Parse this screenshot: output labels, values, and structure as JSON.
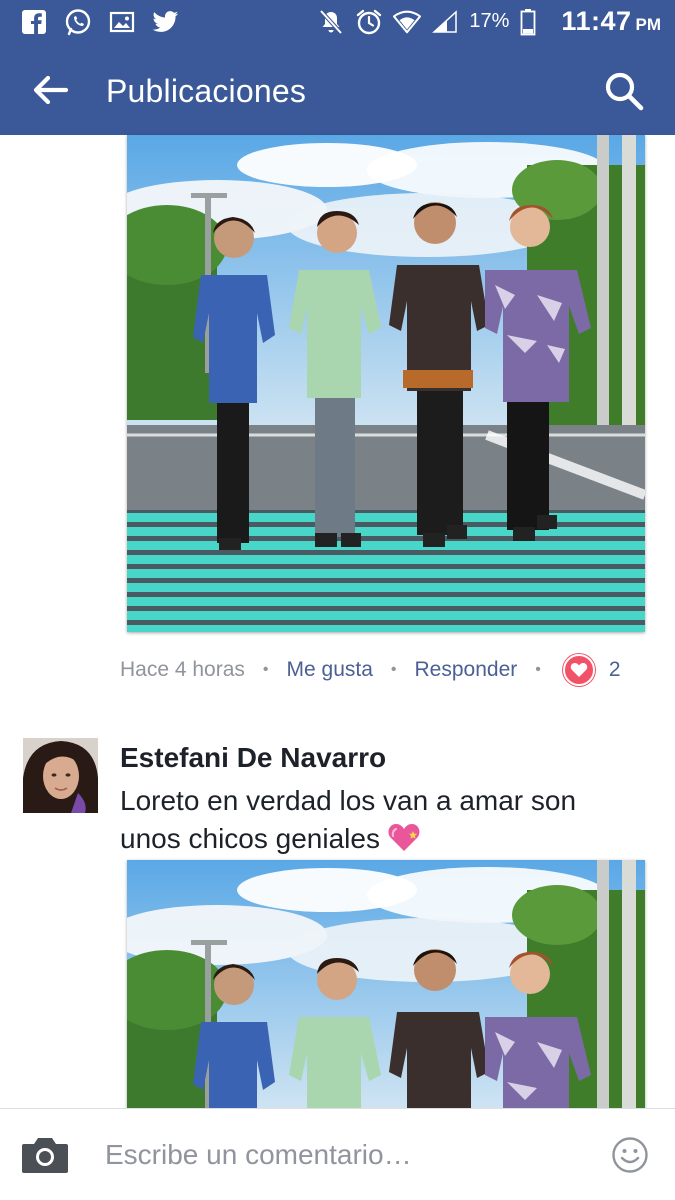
{
  "status_bar": {
    "battery": "17%",
    "time": "11:47",
    "ampm": "PM",
    "left_icons": [
      "facebook-icon",
      "whatsapp-icon",
      "gallery-icon",
      "twitter-icon"
    ],
    "right_icons": [
      "mute-bell-icon",
      "alarm-icon",
      "wifi-icon",
      "signal-icon",
      "battery-icon"
    ]
  },
  "header": {
    "title": "Publicaciones",
    "back_icon": "arrow-left-icon",
    "search_icon": "search-icon"
  },
  "post_meta": {
    "time": "Hace 4 horas",
    "like_label": "Me gusta",
    "reply_label": "Responder",
    "reaction": "heart",
    "reaction_count": "2"
  },
  "comment": {
    "author": "Estefani De Navarro",
    "text": "Loreto en verdad los van a amar son unos chicos geniales",
    "emoji": "sparkling-heart-icon"
  },
  "composer": {
    "placeholder": "Escribe un comentario…",
    "camera_icon": "camera-icon",
    "emoji_icon": "smiley-icon"
  },
  "colors": {
    "brand": "#3b5998",
    "link": "#4b6095",
    "muted": "#90949c",
    "heart": "#f25268"
  }
}
